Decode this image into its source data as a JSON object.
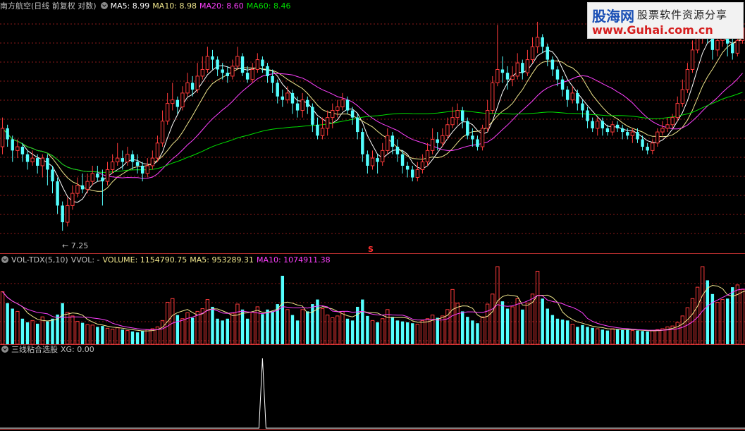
{
  "main_header": {
    "stock": "南方航空(日线 前复权 对数)",
    "ma5": "MA5: 8.99",
    "ma10": "MA10: 8.98",
    "ma20": "MA20: 8.60",
    "ma60": "MA60: 8.46",
    "low_marker": "7.25",
    "signal_marker": "S"
  },
  "volume_header": {
    "name": "VOL-TDX(5,10)",
    "vvol": "VVOL: -",
    "volume": "VOLUME: 1154790.75",
    "ma5": "MA5: 953289.31",
    "ma10": "MA10: 1074911.38"
  },
  "indicator_header": {
    "name": "三线粘合选股",
    "xg": "XG: 0.00"
  },
  "logo": {
    "title": "股海网",
    "slogan": "股票软件资源分享",
    "url": "www.Guhai.com.cn"
  },
  "colors": {
    "up": "#ff3b3b",
    "down": "#54ffff",
    "ma5": "#ffffff",
    "ma10": "#f0e68c",
    "ma20": "#ff40ff",
    "ma60": "#00e000",
    "grid": "#8b1a1a",
    "border": "#c03030"
  },
  "chart_data": [
    {
      "type": "candlestick",
      "title": "南方航空(日线 前复权 对数)",
      "ylim": [
        7.0,
        10.3
      ],
      "candles": [
        [
          8.3,
          8.55,
          8.7,
          8.2
        ],
        [
          8.55,
          8.4,
          8.6,
          8.3
        ],
        [
          8.4,
          8.25,
          8.45,
          8.1
        ],
        [
          8.25,
          8.3,
          8.4,
          8.15
        ],
        [
          8.3,
          8.2,
          8.35,
          8.1
        ],
        [
          8.2,
          8.1,
          8.25,
          8.0
        ],
        [
          8.1,
          8.15,
          8.25,
          8.05
        ],
        [
          8.15,
          8.05,
          8.2,
          7.95
        ],
        [
          8.05,
          8.15,
          8.2,
          7.9
        ],
        [
          8.15,
          8.0,
          8.2,
          7.8
        ],
        [
          8.0,
          7.85,
          8.05,
          7.7
        ],
        [
          7.85,
          7.55,
          7.9,
          7.45
        ],
        [
          7.55,
          7.35,
          7.6,
          7.25
        ],
        [
          7.35,
          7.55,
          7.65,
          7.3
        ],
        [
          7.55,
          7.7,
          7.8,
          7.5
        ],
        [
          7.7,
          7.8,
          7.9,
          7.65
        ],
        [
          7.8,
          7.75,
          7.95,
          7.7
        ],
        [
          7.75,
          7.85,
          7.95,
          7.7
        ],
        [
          7.85,
          7.95,
          8.05,
          7.8
        ],
        [
          7.95,
          7.9,
          8.05,
          7.85
        ],
        [
          7.9,
          7.85,
          8.0,
          7.55
        ],
        [
          7.85,
          8.0,
          8.1,
          7.8
        ],
        [
          8.0,
          8.1,
          8.2,
          7.95
        ],
        [
          8.1,
          8.15,
          8.35,
          8.05
        ],
        [
          8.15,
          8.1,
          8.25,
          8.0
        ],
        [
          8.1,
          8.2,
          8.3,
          8.05
        ],
        [
          8.2,
          8.1,
          8.25,
          8.0
        ],
        [
          8.1,
          8.05,
          8.2,
          7.95
        ],
        [
          8.05,
          7.95,
          8.1,
          7.85
        ],
        [
          7.95,
          8.05,
          8.15,
          7.9
        ],
        [
          8.05,
          8.15,
          8.25,
          8.0
        ],
        [
          8.15,
          8.35,
          8.45,
          8.1
        ],
        [
          8.35,
          8.65,
          8.8,
          8.3
        ],
        [
          8.65,
          8.9,
          9.05,
          8.6
        ],
        [
          8.9,
          8.95,
          9.2,
          8.8
        ],
        [
          8.95,
          8.85,
          9.0,
          8.75
        ],
        [
          8.85,
          9.05,
          9.15,
          8.8
        ],
        [
          9.05,
          9.2,
          9.35,
          9.0
        ],
        [
          9.2,
          9.1,
          9.3,
          9.0
        ],
        [
          9.1,
          9.3,
          9.5,
          9.05
        ],
        [
          9.3,
          9.4,
          9.6,
          9.25
        ],
        [
          9.4,
          9.6,
          9.75,
          9.35
        ],
        [
          9.6,
          9.55,
          9.7,
          9.4
        ],
        [
          9.55,
          9.4,
          9.6,
          9.3
        ],
        [
          9.4,
          9.35,
          9.5,
          9.25
        ],
        [
          9.35,
          9.3,
          9.45,
          9.2
        ],
        [
          9.3,
          9.45,
          9.55,
          9.25
        ],
        [
          9.45,
          9.6,
          9.75,
          9.4
        ],
        [
          9.6,
          9.35,
          9.65,
          9.3
        ],
        [
          9.35,
          9.25,
          9.45,
          9.2
        ],
        [
          9.25,
          9.4,
          9.5,
          9.2
        ],
        [
          9.4,
          9.55,
          9.65,
          9.35
        ],
        [
          9.55,
          9.45,
          9.6,
          9.35
        ],
        [
          9.45,
          9.3,
          9.5,
          9.2
        ],
        [
          9.3,
          9.2,
          9.4,
          9.05
        ],
        [
          9.2,
          9.0,
          9.25,
          8.9
        ],
        [
          9.0,
          8.95,
          9.1,
          8.85
        ],
        [
          8.95,
          9.05,
          9.15,
          8.9
        ],
        [
          9.05,
          8.9,
          9.1,
          8.75
        ],
        [
          8.9,
          8.8,
          9.0,
          8.7
        ],
        [
          8.8,
          8.95,
          9.05,
          8.7
        ],
        [
          8.95,
          8.85,
          9.0,
          8.75
        ],
        [
          8.85,
          8.6,
          8.9,
          8.5
        ],
        [
          8.6,
          8.45,
          8.7,
          8.4
        ],
        [
          8.45,
          8.55,
          8.7,
          8.4
        ],
        [
          8.55,
          8.7,
          8.8,
          8.45
        ],
        [
          8.7,
          8.8,
          8.9,
          8.55
        ],
        [
          8.8,
          8.85,
          8.95,
          8.7
        ],
        [
          8.85,
          8.95,
          9.05,
          8.8
        ],
        [
          8.95,
          8.8,
          9.0,
          8.75
        ],
        [
          8.8,
          8.7,
          8.85,
          8.6
        ],
        [
          8.7,
          8.5,
          8.75,
          8.4
        ],
        [
          8.5,
          8.2,
          8.55,
          8.1
        ],
        [
          8.2,
          8.05,
          8.25,
          7.95
        ],
        [
          8.05,
          8.15,
          8.25,
          8.0
        ],
        [
          8.15,
          8.1,
          8.2,
          7.95
        ],
        [
          8.1,
          8.25,
          8.35,
          8.05
        ],
        [
          8.25,
          8.45,
          8.55,
          8.2
        ],
        [
          8.45,
          8.3,
          8.5,
          8.2
        ],
        [
          8.3,
          8.2,
          8.4,
          8.1
        ],
        [
          8.2,
          8.05,
          8.25,
          7.95
        ],
        [
          8.05,
          8.0,
          8.1,
          7.9
        ],
        [
          8.0,
          7.9,
          8.05,
          7.85
        ],
        [
          7.9,
          8.0,
          8.1,
          7.85
        ],
        [
          8.0,
          8.1,
          8.2,
          7.95
        ],
        [
          8.1,
          8.25,
          8.35,
          8.05
        ],
        [
          8.25,
          8.4,
          8.55,
          8.2
        ],
        [
          8.4,
          8.35,
          8.5,
          8.25
        ],
        [
          8.35,
          8.45,
          8.55,
          8.3
        ],
        [
          8.45,
          8.6,
          8.7,
          8.4
        ],
        [
          8.6,
          8.7,
          8.85,
          8.55
        ],
        [
          8.7,
          8.8,
          8.9,
          8.6
        ],
        [
          8.8,
          8.65,
          8.85,
          8.55
        ],
        [
          8.65,
          8.45,
          8.7,
          8.4
        ],
        [
          8.45,
          8.4,
          8.55,
          8.3
        ],
        [
          8.4,
          8.3,
          8.45,
          8.25
        ],
        [
          8.3,
          8.55,
          8.6,
          8.25
        ],
        [
          8.55,
          8.8,
          8.95,
          8.5
        ],
        [
          8.8,
          9.2,
          9.3,
          8.75
        ],
        [
          9.2,
          9.4,
          10.1,
          9.15
        ],
        [
          9.4,
          9.35,
          9.6,
          9.2
        ],
        [
          9.35,
          9.25,
          9.45,
          9.1
        ],
        [
          9.25,
          9.3,
          9.45,
          9.15
        ],
        [
          9.3,
          9.5,
          9.65,
          9.25
        ],
        [
          9.5,
          9.35,
          9.55,
          9.25
        ],
        [
          9.35,
          9.55,
          9.7,
          9.3
        ],
        [
          9.55,
          9.75,
          9.9,
          9.5
        ],
        [
          9.75,
          9.9,
          10.15,
          9.65
        ],
        [
          9.9,
          9.75,
          9.95,
          9.65
        ],
        [
          9.75,
          9.55,
          9.8,
          9.45
        ],
        [
          9.55,
          9.4,
          9.6,
          9.3
        ],
        [
          9.4,
          9.25,
          9.45,
          9.15
        ],
        [
          9.25,
          9.1,
          9.3,
          9.0
        ],
        [
          9.1,
          8.95,
          9.15,
          8.85
        ],
        [
          8.95,
          9.05,
          9.15,
          8.9
        ],
        [
          9.05,
          8.9,
          9.1,
          8.8
        ],
        [
          8.9,
          8.8,
          8.95,
          8.7
        ],
        [
          8.8,
          8.65,
          8.85,
          8.55
        ],
        [
          8.65,
          8.55,
          8.7,
          8.5
        ],
        [
          8.55,
          8.65,
          8.7,
          8.45
        ],
        [
          8.65,
          8.55,
          8.7,
          8.45
        ],
        [
          8.55,
          8.5,
          8.6,
          8.45
        ],
        [
          8.5,
          8.6,
          8.65,
          8.45
        ],
        [
          8.6,
          8.55,
          8.65,
          8.5
        ],
        [
          8.55,
          8.5,
          8.6,
          8.4
        ],
        [
          8.5,
          8.45,
          8.55,
          8.4
        ],
        [
          8.45,
          8.5,
          8.55,
          8.35
        ],
        [
          8.5,
          8.4,
          8.55,
          8.35
        ],
        [
          8.4,
          8.3,
          8.45,
          8.25
        ],
        [
          8.3,
          8.25,
          8.35,
          8.2
        ],
        [
          8.25,
          8.35,
          8.4,
          8.2
        ],
        [
          8.35,
          8.5,
          8.55,
          8.3
        ],
        [
          8.5,
          8.55,
          8.65,
          8.45
        ],
        [
          8.55,
          8.6,
          8.7,
          8.5
        ],
        [
          8.6,
          8.7,
          8.75,
          8.55
        ],
        [
          8.7,
          8.9,
          9.0,
          8.65
        ],
        [
          8.9,
          9.1,
          9.25,
          8.85
        ],
        [
          9.1,
          9.4,
          9.5,
          9.05
        ],
        [
          9.4,
          9.7,
          9.85,
          9.35
        ],
        [
          9.7,
          9.95,
          10.2,
          9.65
        ],
        [
          9.95,
          10.1,
          10.3,
          9.8
        ],
        [
          10.1,
          9.9,
          10.2,
          9.8
        ],
        [
          9.9,
          9.7,
          10.0,
          9.55
        ],
        [
          9.7,
          9.85,
          10.0,
          9.6
        ],
        [
          9.85,
          10.0,
          10.15,
          9.75
        ],
        [
          10.0,
          9.8,
          10.05,
          9.6
        ],
        [
          9.8,
          9.65,
          9.9,
          9.55
        ],
        [
          9.65,
          9.85,
          10.05,
          9.6
        ],
        [
          9.85,
          10.05,
          10.2,
          9.8
        ]
      ],
      "ma_lines": [
        "MA5",
        "MA10",
        "MA20",
        "MA60"
      ],
      "low_annotation": 7.25
    },
    {
      "type": "bar",
      "title": "VOL-TDX(5,10)",
      "ylim": [
        0,
        1700000
      ],
      "volumes": [
        1150000,
        900000,
        780000,
        720000,
        560000,
        480000,
        520000,
        450000,
        600000,
        500000,
        560000,
        650000,
        900000,
        700000,
        620000,
        500000,
        470000,
        430000,
        420000,
        380000,
        400000,
        350000,
        330000,
        360000,
        320000,
        300000,
        280000,
        260000,
        300000,
        320000,
        340000,
        380000,
        520000,
        920000,
        1000000,
        640000,
        560000,
        690000,
        580000,
        720000,
        780000,
        980000,
        820000,
        560000,
        520000,
        560000,
        680000,
        880000,
        760000,
        560000,
        700000,
        820000,
        660000,
        760000,
        720000,
        880000,
        1500000,
        760000,
        640000,
        520000,
        760000,
        720000,
        880000,
        980000,
        780000,
        640000,
        580000,
        620000,
        720000,
        560000,
        520000,
        820000,
        980000,
        620000,
        520000,
        480000,
        560000,
        760000,
        600000,
        520000,
        500000,
        480000,
        460000,
        440000,
        520000,
        560000,
        640000,
        580000,
        620000,
        760000,
        1200000,
        900000,
        720000,
        600000,
        520000,
        460000,
        600000,
        880000,
        1100000,
        1700000,
        940000,
        780000,
        820000,
        1000000,
        760000,
        900000,
        1100000,
        1600000,
        1000000,
        780000,
        640000,
        560000,
        540000,
        520000,
        440000,
        380000,
        420000,
        380000,
        360000,
        340000,
        320000,
        300000,
        340000,
        330000,
        310000,
        320000,
        300000,
        300000,
        290000,
        280000,
        300000,
        320000,
        340000,
        380000,
        400000,
        480000,
        620000,
        800000,
        1000000,
        1250000,
        1700000,
        1400000,
        1100000,
        920000,
        980000,
        1000000,
        1250000,
        1300000,
        1200000,
        1150000
      ],
      "series": [
        {
          "name": "MA5",
          "last": 953289.31
        },
        {
          "name": "MA10",
          "last": 1074911.38
        }
      ]
    },
    {
      "type": "line",
      "title": "三线粘合选股",
      "series": [
        {
          "name": "XG",
          "last": 0.0,
          "signal_index": 52
        }
      ],
      "ylim": [
        0,
        1
      ]
    }
  ]
}
